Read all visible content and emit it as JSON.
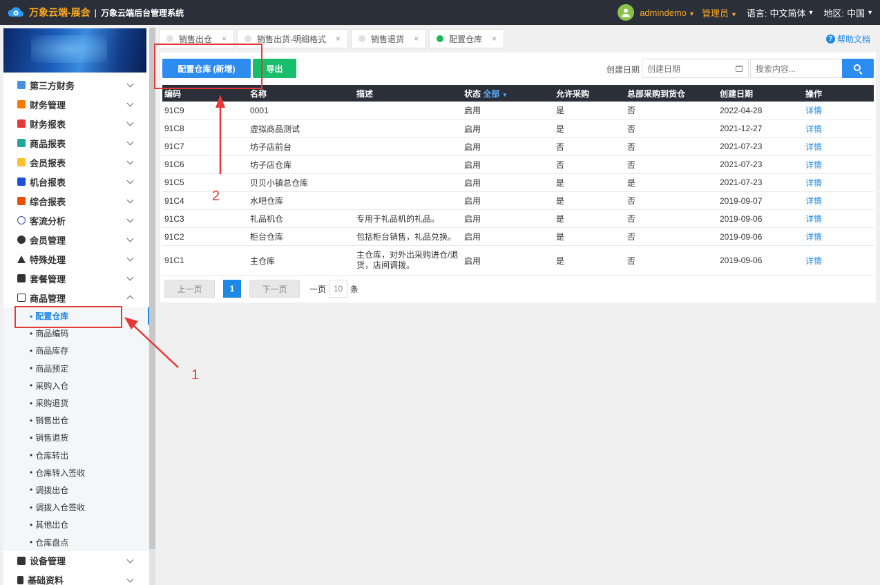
{
  "header": {
    "brand": "万象云端-展会",
    "separator": "|",
    "subtitle": "万象云端后台管理系统",
    "username": "admindemo",
    "role": "管理员",
    "language_label": "语言:",
    "language_value": "中文简体",
    "region_label": "地区:",
    "region_value": "中国"
  },
  "sidebar": {
    "items": [
      {
        "label": "第三方财务",
        "icon": "calculator-icon",
        "color": "#4a90e2"
      },
      {
        "label": "财务管理",
        "icon": "ledger-icon",
        "color": "#f57c00"
      },
      {
        "label": "财务报表",
        "icon": "report-icon",
        "color": "#e53935"
      },
      {
        "label": "商品报表",
        "icon": "goods-report-icon",
        "color": "#26a69a"
      },
      {
        "label": "会员报表",
        "icon": "member-report-icon",
        "color": "#fbc02d"
      },
      {
        "label": "机台报表",
        "icon": "machine-report-icon",
        "color": "#1e4fd8"
      },
      {
        "label": "综合报表",
        "icon": "layers-icon",
        "color": "#e65100"
      },
      {
        "label": "客流分析",
        "icon": "target-icon",
        "color": "#3949ab"
      },
      {
        "label": "会员管理",
        "icon": "user-icon",
        "color": "#333333"
      },
      {
        "label": "特殊处理",
        "icon": "warning-icon",
        "color": "#333333"
      },
      {
        "label": "套餐管理",
        "icon": "edit-icon",
        "color": "#333333"
      },
      {
        "label": "商品管理",
        "icon": "exchange-icon",
        "color": "#333333"
      }
    ],
    "sub_items": [
      "配置仓库",
      "商品编码",
      "商品库存",
      "商品预定",
      "采购入仓",
      "采购退货",
      "销售出仓",
      "销售退货",
      "仓库转出",
      "仓库转入签收",
      "调拨出仓",
      "调拨入仓签收",
      "其他出仓",
      "仓库盘点"
    ],
    "bottom_items": [
      {
        "label": "设备管理",
        "icon": "device-icon"
      },
      {
        "label": "基础资料",
        "icon": "file-icon"
      }
    ]
  },
  "tabs": [
    {
      "label": "销售出仓",
      "close": "×"
    },
    {
      "label": "销售出货-明细格式",
      "close": "×"
    },
    {
      "label": "销售退货",
      "close": "×"
    },
    {
      "label": "配置仓库",
      "close": "×"
    }
  ],
  "help_label": "帮助文档",
  "toolbar": {
    "add_label": "配置仓库 (新增)",
    "export_label": "导出",
    "date_label": "创建日期",
    "date_placeholder": "创建日期",
    "search_placeholder": "搜索内容..."
  },
  "table": {
    "headers": [
      "编码",
      "名称",
      "描述",
      "状态",
      "允许采购",
      "总部采购到货仓",
      "创建日期",
      "操作"
    ],
    "status_filter": "全部",
    "rows": [
      {
        "code": "91C9",
        "name": "0001",
        "desc": "",
        "status": "启用",
        "purchase": "是",
        "hq": "否",
        "date": "2022-04-28",
        "action": "详情"
      },
      {
        "code": "91C8",
        "name": "虚拟商品测试",
        "desc": "",
        "status": "启用",
        "purchase": "是",
        "hq": "否",
        "date": "2021-12-27",
        "action": "详情"
      },
      {
        "code": "91C7",
        "name": "坊子店前台",
        "desc": "",
        "status": "启用",
        "purchase": "否",
        "hq": "否",
        "date": "2021-07-23",
        "action": "详情"
      },
      {
        "code": "91C6",
        "name": "坊子店仓库",
        "desc": "",
        "status": "启用",
        "purchase": "否",
        "hq": "否",
        "date": "2021-07-23",
        "action": "详情"
      },
      {
        "code": "91C5",
        "name": "贝贝小镇总仓库",
        "desc": "",
        "status": "启用",
        "purchase": "是",
        "hq": "是",
        "date": "2021-07-23",
        "action": "详情"
      },
      {
        "code": "91C4",
        "name": "水吧仓库",
        "desc": "",
        "status": "启用",
        "purchase": "是",
        "hq": "否",
        "date": "2019-09-07",
        "action": "详情"
      },
      {
        "code": "91C3",
        "name": "礼品机仓",
        "desc": "专用于礼品机的礼品。",
        "status": "启用",
        "purchase": "是",
        "hq": "否",
        "date": "2019-09-06",
        "action": "详情"
      },
      {
        "code": "91C2",
        "name": "柜台仓库",
        "desc": "包括柜台销售，礼品兑换。",
        "status": "启用",
        "purchase": "是",
        "hq": "否",
        "date": "2019-09-06",
        "action": "详情"
      },
      {
        "code": "91C1",
        "name": "主仓库",
        "desc": "主仓库，对外出采购进仓/退货，店间调拨。",
        "status": "启用",
        "purchase": "是",
        "hq": "否",
        "date": "2019-09-06",
        "action": "详情"
      }
    ]
  },
  "pager": {
    "prev_label": "上一页",
    "current_page": "1",
    "next_label": "下一页",
    "per_page_prefix": "一页",
    "per_page_value": "10",
    "per_page_suffix": "条"
  },
  "annotations": {
    "label_1": "1",
    "label_2": "2",
    "color": "#e53935"
  }
}
